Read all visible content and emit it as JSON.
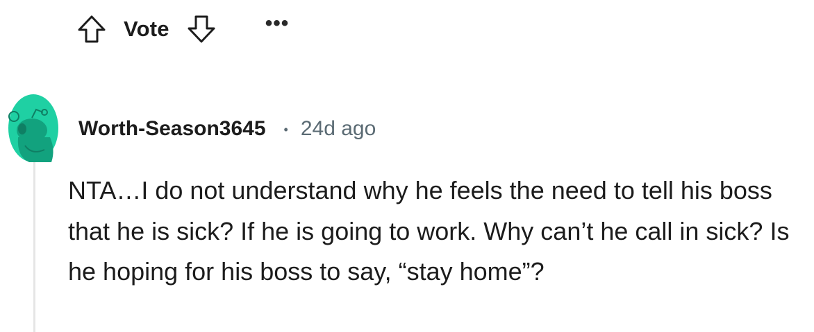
{
  "vote_bar": {
    "upvote_icon": "arrow-up-outline-icon",
    "label": "Vote",
    "downvote_icon": "arrow-down-outline-icon",
    "more_label": "•••"
  },
  "comment": {
    "avatar_icon": "reddit-snoo-avatar",
    "username": "Worth-Season3645",
    "separator": "•",
    "timestamp": "24d ago",
    "body": "NTA…I do not understand why he feels the need to tell his boss that he is sick? If he is going to work. Why can’t he call in sick? Is he hoping for his boss to say, “stay home”?"
  },
  "colors": {
    "avatar_bg": "#1fd0a3",
    "avatar_figure": "#12a27e",
    "meta_gray": "#5a6a73",
    "thread_line": "#e5e5e5"
  }
}
